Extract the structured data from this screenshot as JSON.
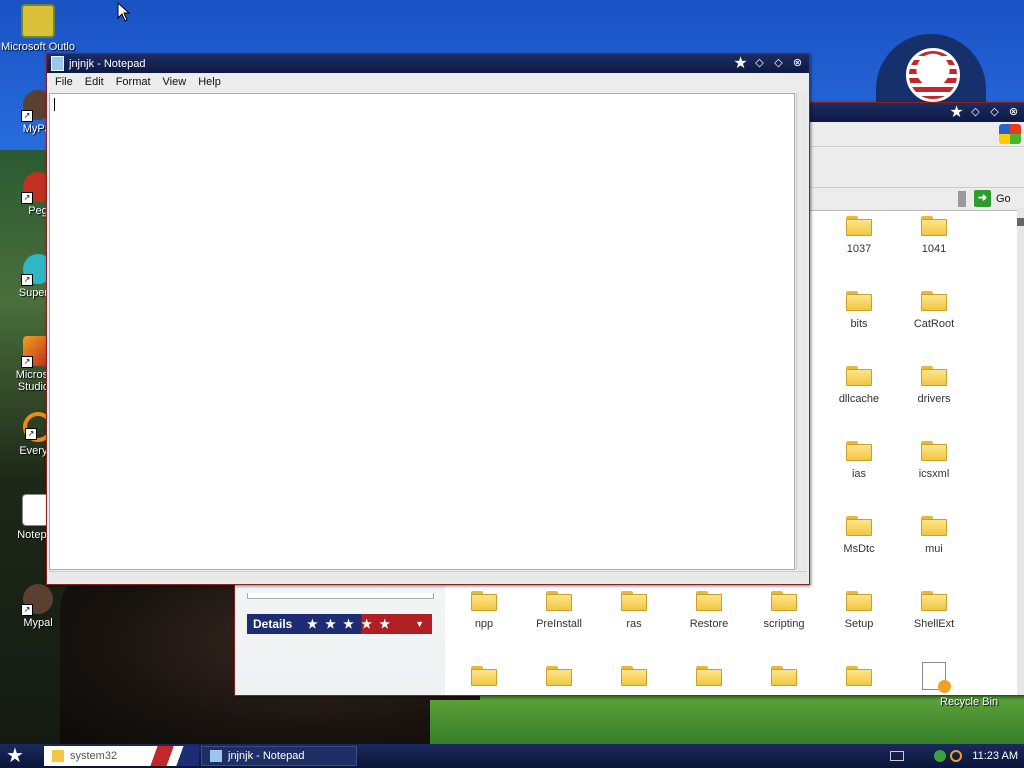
{
  "desktop": {
    "icons": [
      {
        "label": "Microsoft Outlo",
        "name": "outlook-icon"
      },
      {
        "label": "MyPal",
        "name": "mypal-icon"
      },
      {
        "label": "Peg",
        "name": "pegasus-icon"
      },
      {
        "label": "Superm",
        "name": "supermium-icon"
      },
      {
        "label": "Microsoft Studio 2",
        "name": "visual-studio-icon"
      },
      {
        "label": "Everyth",
        "name": "everything-icon"
      },
      {
        "label": "Notepad",
        "name": "notepad-icon"
      },
      {
        "label": "Mypal",
        "name": "mypal2-icon"
      }
    ],
    "recycle_bin": "Recycle Bin"
  },
  "notepad": {
    "title": "jnjnjk - Notepad",
    "menus": [
      "File",
      "Edit",
      "Format",
      "View",
      "Help"
    ],
    "content": ""
  },
  "explorer": {
    "go_label": "Go",
    "details_label": "Details",
    "folders": [
      {
        "label": "1037"
      },
      {
        "label": "1041"
      },
      {
        "label": "bits"
      },
      {
        "label": "CatRoot"
      },
      {
        "label": "dllcache"
      },
      {
        "label": "drivers"
      },
      {
        "label": "ias"
      },
      {
        "label": "icsxml"
      },
      {
        "label": "MsDtc"
      },
      {
        "label": "mui"
      },
      {
        "label": "npp"
      },
      {
        "label": "PreInstall"
      },
      {
        "label": "ras"
      },
      {
        "label": "Restore"
      },
      {
        "label": "scripting"
      },
      {
        "label": "Setup"
      },
      {
        "label": "ShellExt"
      }
    ]
  },
  "taskbar": {
    "tasks": [
      {
        "label": "system32"
      },
      {
        "label": "jnjnjk - Notepad"
      }
    ],
    "clock": "11:23 AM"
  }
}
